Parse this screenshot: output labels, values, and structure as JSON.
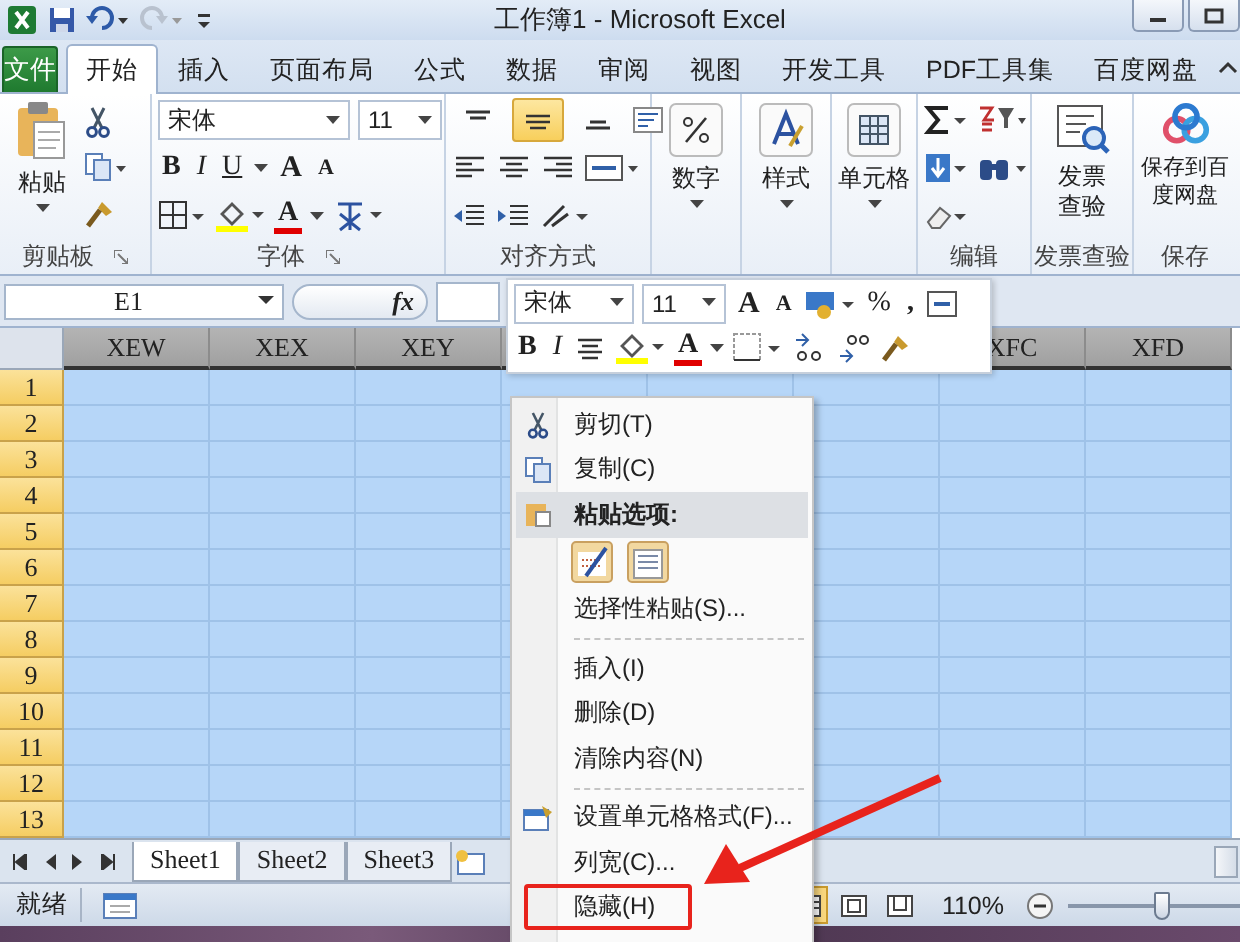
{
  "window": {
    "title": "工作簿1 - Microsoft Excel"
  },
  "file_tab": {
    "label": "文件"
  },
  "tabs": [
    {
      "label": "开始",
      "selected": true
    },
    {
      "label": "插入",
      "selected": false
    },
    {
      "label": "页面布局",
      "selected": false
    },
    {
      "label": "公式",
      "selected": false
    },
    {
      "label": "数据",
      "selected": false
    },
    {
      "label": "审阅",
      "selected": false
    },
    {
      "label": "视图",
      "selected": false
    },
    {
      "label": "开发工具",
      "selected": false
    },
    {
      "label": "PDF工具集",
      "selected": false
    },
    {
      "label": "百度网盘",
      "selected": false
    }
  ],
  "ribbon": {
    "clipboard": {
      "paste": "粘贴",
      "group": "剪贴板"
    },
    "font": {
      "name": "宋体",
      "size": "11",
      "bold": "B",
      "italic": "I",
      "underline": "U",
      "grow": "A",
      "shrink": "A",
      "font_color": "A",
      "group": "字体"
    },
    "alignment": {
      "group": "对齐方式",
      "vertical": [
        {
          "kind": "top",
          "selected": false
        },
        {
          "kind": "middle",
          "selected": true
        },
        {
          "kind": "bottom",
          "selected": false
        }
      ]
    },
    "big_buttons": [
      {
        "kind": "number",
        "label": "数字"
      },
      {
        "kind": "styles",
        "label": "样式"
      },
      {
        "kind": "cells",
        "label": "单元格"
      }
    ],
    "editing": {
      "group": "编辑"
    },
    "invoice": {
      "label": "发票查验",
      "group": "发票查验"
    },
    "save": {
      "label": "保存到百度网盘",
      "group": "保存"
    }
  },
  "name_box": {
    "value": "E1"
  },
  "formula_bar": {
    "function_label": "fx"
  },
  "columns_left": [
    "XEW",
    "XEX",
    "XEY"
  ],
  "columns_right": [
    "XFC",
    "XFD"
  ],
  "rows": [
    {
      "label": "1",
      "selected": true
    },
    {
      "label": "2",
      "selected": true
    },
    {
      "label": "3",
      "selected": true
    },
    {
      "label": "4",
      "selected": true
    },
    {
      "label": "5",
      "selected": true
    },
    {
      "label": "6",
      "selected": true
    },
    {
      "label": "7",
      "selected": true
    },
    {
      "label": "8",
      "selected": true
    },
    {
      "label": "9",
      "selected": true
    },
    {
      "label": "10",
      "selected": true
    },
    {
      "label": "11",
      "selected": true
    },
    {
      "label": "12",
      "selected": true
    },
    {
      "label": "13",
      "selected": true
    }
  ],
  "sheet_tabs": [
    {
      "label": "Sheet1",
      "selected": true
    },
    {
      "label": "Sheet2",
      "selected": false
    },
    {
      "label": "Sheet3",
      "selected": false
    }
  ],
  "status_bar": {
    "status": "就绪",
    "zoom": "110%",
    "zoom_slider": {
      "level": 0.55
    }
  },
  "mini_toolbar": {
    "font": "宋体",
    "size": "11",
    "grow": "A",
    "shrink": "A",
    "percent": "%",
    "comma": ",",
    "bold": "B",
    "italic": "I",
    "font_color": "A"
  },
  "context_menu": {
    "items": [
      {
        "kind": "cut",
        "label": "剪切(T)"
      },
      {
        "kind": "copy",
        "label": "复制(C)"
      },
      {
        "kind": "header",
        "label": "粘贴选项:"
      },
      {
        "kind": "paste_options"
      },
      {
        "kind": "plain",
        "label": "选择性粘贴(S)..."
      },
      {
        "kind": "separator"
      },
      {
        "kind": "plain",
        "label": "插入(I)"
      },
      {
        "kind": "plain",
        "label": "删除(D)"
      },
      {
        "kind": "plain",
        "label": "清除内容(N)"
      },
      {
        "kind": "separator"
      },
      {
        "kind": "format",
        "label": "设置单元格格式(F)..."
      },
      {
        "kind": "plain",
        "label": "列宽(C)..."
      },
      {
        "kind": "plain",
        "label": "隐藏(H)",
        "annotated": true
      }
    ]
  }
}
